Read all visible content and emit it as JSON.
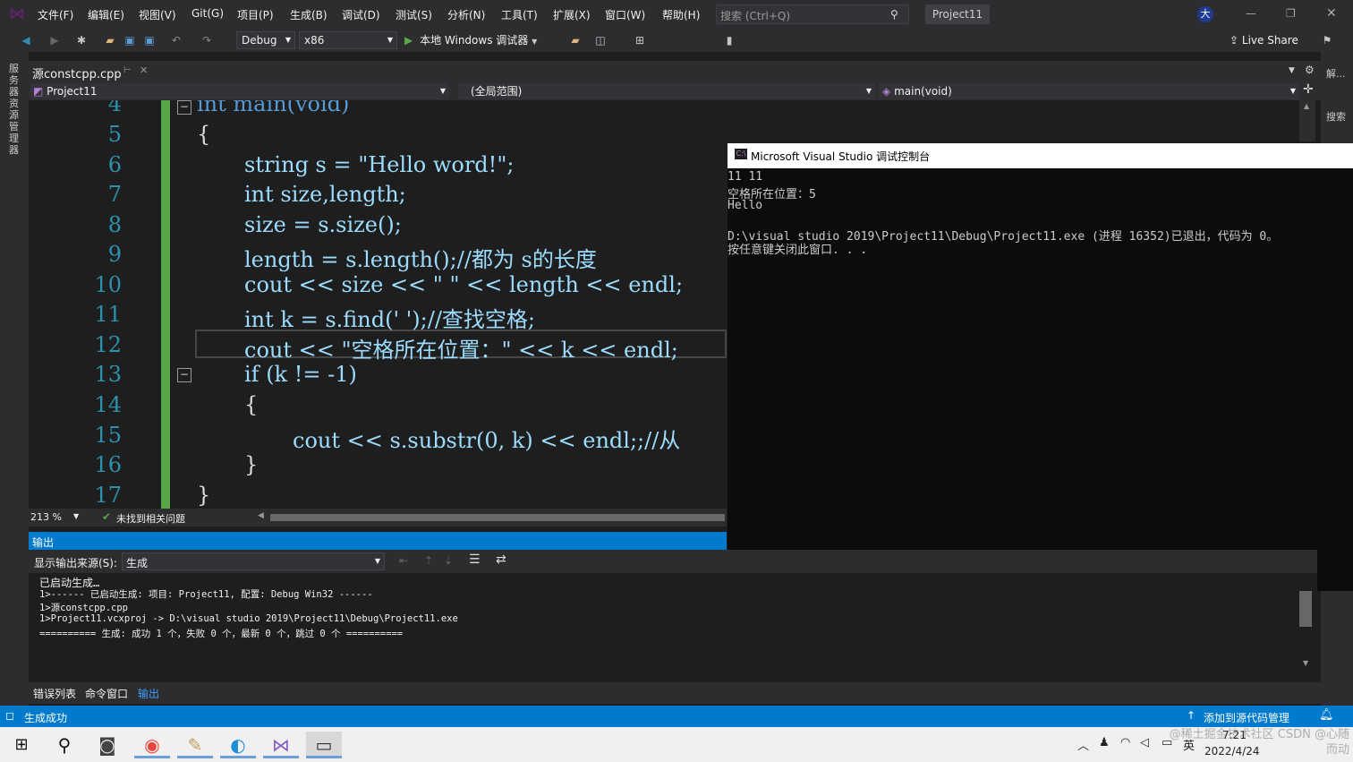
{
  "menubar": {
    "items": [
      "文件(F)",
      "编辑(E)",
      "视图(V)",
      "Git(G)",
      "项目(P)",
      "生成(B)",
      "调试(D)",
      "测试(S)",
      "分析(N)",
      "工具(T)",
      "扩展(X)",
      "窗口(W)",
      "帮助(H)"
    ],
    "search_placeholder": "搜索 (Ctrl+Q)",
    "project_title": "Project11",
    "user_initial": "大"
  },
  "toolbar": {
    "config": "Debug",
    "platform": "x86",
    "run_label": "本地 Windows 调试器",
    "live_share": "Live Share"
  },
  "left_strip": {
    "label": "服务器资源管理器"
  },
  "right_rail": {
    "label_top": "解...",
    "label_search": "搜索"
  },
  "editor": {
    "tab_name": "源constcpp.cpp",
    "nav_project": "Project11",
    "nav_scope": "(全局范围)",
    "nav_function": "main(void)",
    "lines": [
      {
        "num": "4",
        "text": "int main(void)"
      },
      {
        "num": "5",
        "text": "{"
      },
      {
        "num": "6",
        "text": "string s = \"Hello word!\";"
      },
      {
        "num": "7",
        "text": "int size,length;"
      },
      {
        "num": "8",
        "text": "size = s.size();"
      },
      {
        "num": "9",
        "text": "length = s.length();//都为 s的长度"
      },
      {
        "num": "10",
        "text": "cout << size << \" \" << length << endl;"
      },
      {
        "num": "11",
        "text": "int k = s.find(' ');//查找空格;"
      },
      {
        "num": "12",
        "text": "cout << \"空格所在位置：\" << k << endl;"
      },
      {
        "num": "13",
        "text": "if (k != -1)"
      },
      {
        "num": "14",
        "text": "{"
      },
      {
        "num": "15",
        "text": "cout << s.substr(0, k) << endl;;//从"
      },
      {
        "num": "16",
        "text": "}"
      },
      {
        "num": "17",
        "text": "}"
      }
    ],
    "zoom": "213 %",
    "issues": "未找到相关问题"
  },
  "console": {
    "title": "Microsoft Visual Studio 调试控制台",
    "lines": [
      "11 11",
      "空格所在位置：5",
      "Hello",
      "",
      "D:\\visual studio 2019\\Project11\\Debug\\Project11.exe (进程 16352)已退出，代码为 0。",
      "按任意键关闭此窗口. . ."
    ]
  },
  "output": {
    "header": "输出",
    "source_label": "显示输出来源(S):",
    "source_value": "生成",
    "lines": [
      "已启动生成…",
      "1>------ 已启动生成: 项目: Project11, 配置: Debug Win32 ------",
      "1>源constcpp.cpp",
      "1>Project11.vcxproj -> D:\\visual studio 2019\\Project11\\Debug\\Project11.exe",
      "========== 生成: 成功 1 个，失败 0 个，最新 0 个，跳过 0 个 =========="
    ],
    "tabs": [
      "错误列表",
      "命令窗口",
      "输出"
    ]
  },
  "statusbar": {
    "left": "生成成功",
    "right": "添加到源代码管理"
  },
  "taskbar": {
    "ime": "英",
    "time": "7:21",
    "date": "2022/4/24",
    "watermark": "@稀土掘金技术社区 CSDN @心随而动"
  },
  "colors": {
    "accent": "#007acc",
    "keyword": "#569cd6",
    "string": "#d69d85",
    "comment": "#57a64a",
    "line_number": "#2b91af"
  }
}
